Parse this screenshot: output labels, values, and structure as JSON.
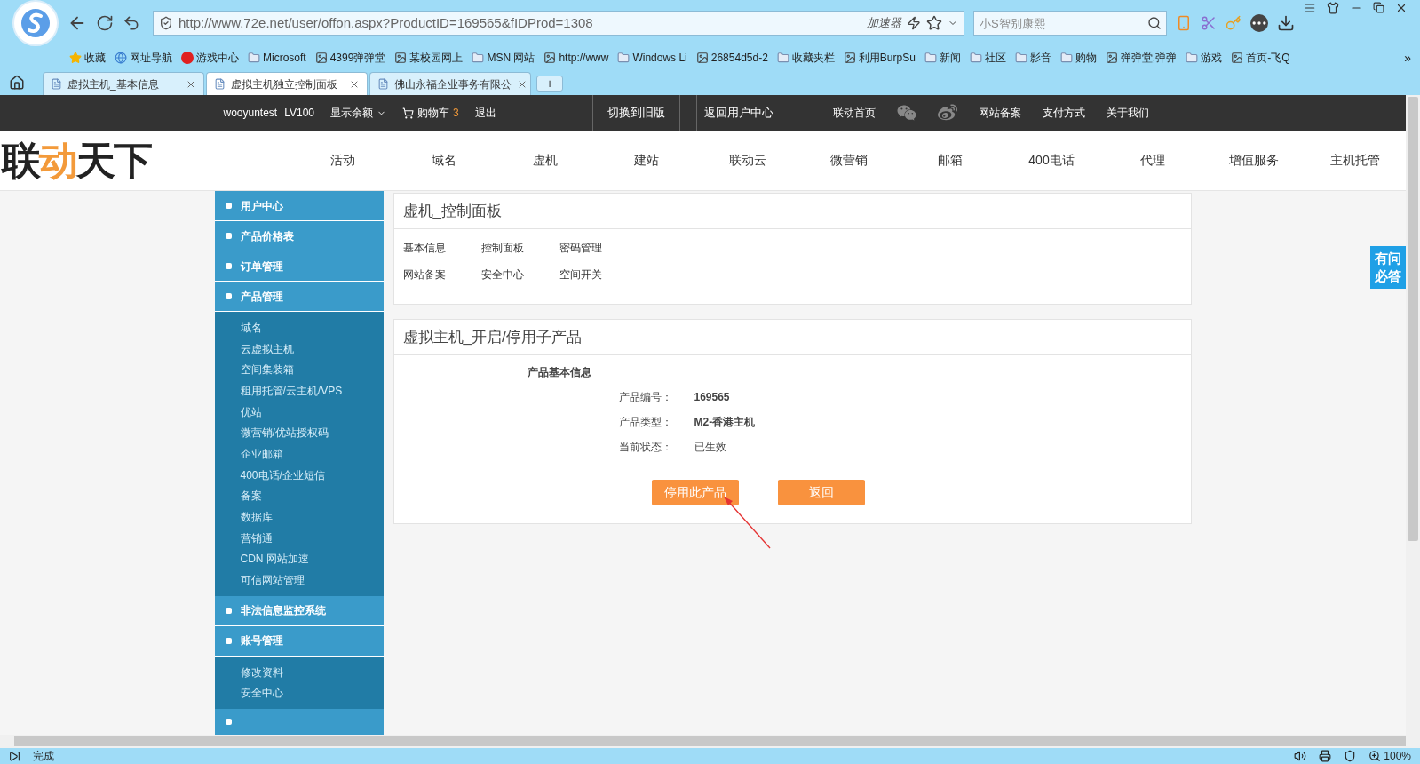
{
  "browser": {
    "url": "http://www.72e.net/user/offon.aspx?ProductID=169565&fIDProd=1308",
    "accelerator": "加速器",
    "search": {
      "placeholder": "小S智别康熙"
    },
    "bookmarks": [
      {
        "kind": "star",
        "label": "收藏"
      },
      {
        "kind": "globe",
        "label": "网址导航"
      },
      {
        "kind": "badge",
        "label": "游戏中心"
      },
      {
        "kind": "folder",
        "label": "Microsoft"
      },
      {
        "kind": "image",
        "label": "4399弹弹堂"
      },
      {
        "kind": "image",
        "label": "某校园网上"
      },
      {
        "kind": "folder",
        "label": "MSN 网站"
      },
      {
        "kind": "image",
        "label": "http://www"
      },
      {
        "kind": "folder",
        "label": "Windows Li"
      },
      {
        "kind": "image",
        "label": "26854d5d-2"
      },
      {
        "kind": "folder",
        "label": "收藏夹栏"
      },
      {
        "kind": "image",
        "label": "利用BurpSu"
      },
      {
        "kind": "folder",
        "label": "新闻"
      },
      {
        "kind": "folder",
        "label": "社区"
      },
      {
        "kind": "folder",
        "label": "影音"
      },
      {
        "kind": "folder",
        "label": "购物"
      },
      {
        "kind": "image",
        "label": "弹弹堂,弹弹"
      },
      {
        "kind": "folder",
        "label": "游戏"
      },
      {
        "kind": "image",
        "label": "首页-飞Q"
      }
    ],
    "bookmarks_more": "»",
    "tabs": [
      {
        "label": "虚拟主机_基本信息",
        "selected": false
      },
      {
        "label": "虚拟主机独立控制面板",
        "selected": true
      },
      {
        "label": "佛山永福企业事务有限公",
        "selected": false
      }
    ],
    "new_tab": "+",
    "status": "完成",
    "zoom": "100%"
  },
  "topbar": {
    "user": "wooyuntest",
    "level": "LV100",
    "balance": "显示余额",
    "cart": "购物车",
    "cart_count": "3",
    "logout": "退出",
    "old_version": "切换到旧版",
    "user_center": "返回用户中心",
    "links_left": [
      "联动首页"
    ],
    "links_right": [
      "网站备案",
      "支付方式",
      "关于我们"
    ]
  },
  "logo": [
    {
      "text": "联",
      "accent": false
    },
    {
      "text": "动",
      "accent": true
    },
    {
      "text": "天下",
      "accent": false
    }
  ],
  "nav": [
    "活动",
    "域名",
    "虚机",
    "建站",
    "联动云",
    "微营销",
    "邮箱",
    "400电话",
    "代理",
    "增值服务",
    "主机托管"
  ],
  "sidebar": [
    {
      "label": "用户中心"
    },
    {
      "label": "产品价格表"
    },
    {
      "label": "订单管理"
    },
    {
      "label": "产品管理",
      "children": [
        "域名",
        "云虚拟主机",
        "空间集装箱",
        "租用托管/云主机/VPS",
        "优站",
        "微营销/优站授权码",
        "企业邮箱",
        "400电话/企业短信",
        "备案",
        "数据库",
        "营销通",
        "CDN 网站加速",
        "可信网站管理"
      ]
    },
    {
      "label": "非法信息监控系统"
    },
    {
      "label": "账号管理",
      "children": [
        "修改资料",
        "安全中心"
      ]
    }
  ],
  "control_panel": {
    "title": "虚机_控制面板",
    "links": [
      "基本信息",
      "控制面板",
      "密码管理",
      "网站备案",
      "安全中心",
      "空间开关"
    ]
  },
  "product_panel": {
    "title": "虚拟主机_开启/停用子产品",
    "section": "产品基本信息",
    "fields": [
      {
        "label": "产品编号：",
        "value": "169565",
        "emphasis": true
      },
      {
        "label": "产品类型：",
        "value": "M2-香港主机",
        "emphasis": true
      },
      {
        "label": "当前状态：",
        "value": "已生效",
        "emphasis": false
      }
    ],
    "buttons": [
      "停用此产品",
      "返回"
    ]
  },
  "side_tab": "有问必答"
}
